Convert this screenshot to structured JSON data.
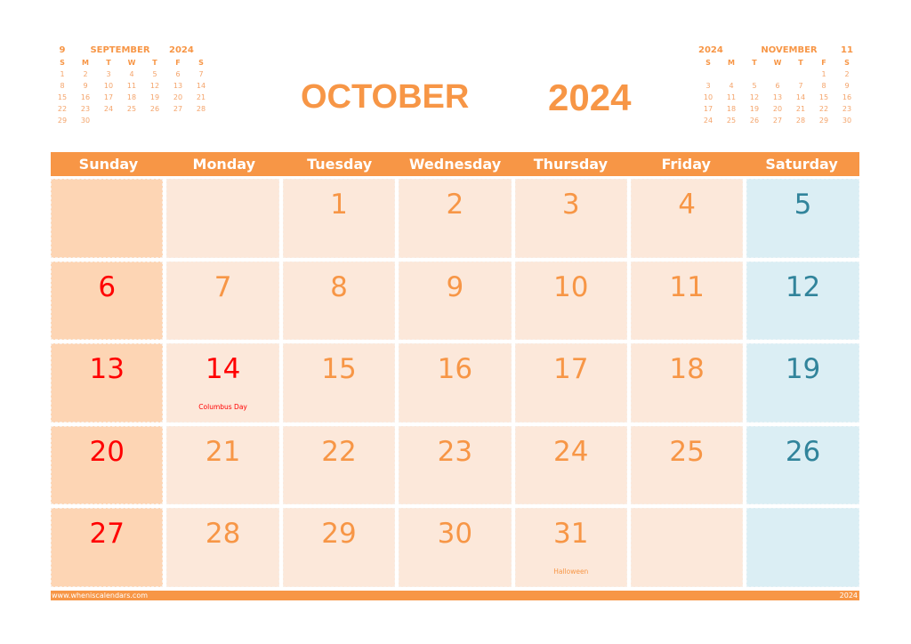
{
  "title": {
    "month": "OCTOBER",
    "year": "2024"
  },
  "colors": {
    "accent": "#f79646",
    "sunday_cell": "#fdd5b4",
    "weekday_cell": "#fce8da",
    "saturday_cell": "#dbeef4",
    "sunday_text": "#ff0000",
    "saturday_text": "#31849b"
  },
  "mini_prev": {
    "month_number": "9",
    "month_name": "SEPTEMBER",
    "year": "2024",
    "dow": [
      "S",
      "M",
      "T",
      "W",
      "T",
      "F",
      "S"
    ],
    "days": [
      "1",
      "2",
      "3",
      "4",
      "5",
      "6",
      "7",
      "8",
      "9",
      "10",
      "11",
      "12",
      "13",
      "14",
      "15",
      "16",
      "17",
      "18",
      "19",
      "20",
      "21",
      "22",
      "23",
      "24",
      "25",
      "26",
      "27",
      "28",
      "29",
      "30",
      "",
      "",
      "",
      "",
      ""
    ]
  },
  "mini_next": {
    "year": "2024",
    "month_name": "NOVEMBER",
    "month_number": "11",
    "dow": [
      "S",
      "M",
      "T",
      "W",
      "T",
      "F",
      "S"
    ],
    "days": [
      "",
      "",
      "",
      "",
      "",
      "1",
      "2",
      "3",
      "4",
      "5",
      "6",
      "7",
      "8",
      "9",
      "10",
      "11",
      "12",
      "13",
      "14",
      "15",
      "16",
      "17",
      "18",
      "19",
      "20",
      "21",
      "22",
      "23",
      "24",
      "25",
      "26",
      "27",
      "28",
      "29",
      "30"
    ]
  },
  "weekdays": [
    "Sunday",
    "Monday",
    "Tuesday",
    "Wednesday",
    "Thursday",
    "Friday",
    "Saturday"
  ],
  "cells": [
    {
      "day": "",
      "note": ""
    },
    {
      "day": "",
      "note": ""
    },
    {
      "day": "1",
      "note": ""
    },
    {
      "day": "2",
      "note": ""
    },
    {
      "day": "3",
      "note": ""
    },
    {
      "day": "4",
      "note": ""
    },
    {
      "day": "5",
      "note": ""
    },
    {
      "day": "6",
      "note": ""
    },
    {
      "day": "7",
      "note": ""
    },
    {
      "day": "8",
      "note": ""
    },
    {
      "day": "9",
      "note": ""
    },
    {
      "day": "10",
      "note": ""
    },
    {
      "day": "11",
      "note": ""
    },
    {
      "day": "12",
      "note": ""
    },
    {
      "day": "13",
      "note": ""
    },
    {
      "day": "14",
      "note": "Columbus Day",
      "holiday": true
    },
    {
      "day": "15",
      "note": ""
    },
    {
      "day": "16",
      "note": ""
    },
    {
      "day": "17",
      "note": ""
    },
    {
      "day": "18",
      "note": ""
    },
    {
      "day": "19",
      "note": ""
    },
    {
      "day": "20",
      "note": ""
    },
    {
      "day": "21",
      "note": ""
    },
    {
      "day": "22",
      "note": ""
    },
    {
      "day": "23",
      "note": ""
    },
    {
      "day": "24",
      "note": ""
    },
    {
      "day": "25",
      "note": ""
    },
    {
      "day": "26",
      "note": ""
    },
    {
      "day": "27",
      "note": ""
    },
    {
      "day": "28",
      "note": ""
    },
    {
      "day": "29",
      "note": ""
    },
    {
      "day": "30",
      "note": ""
    },
    {
      "day": "31",
      "note": "Halloween"
    },
    {
      "day": "",
      "note": ""
    },
    {
      "day": "",
      "note": ""
    }
  ],
  "footer": {
    "site": "www.wheniscalendars.com",
    "year": "2024"
  }
}
